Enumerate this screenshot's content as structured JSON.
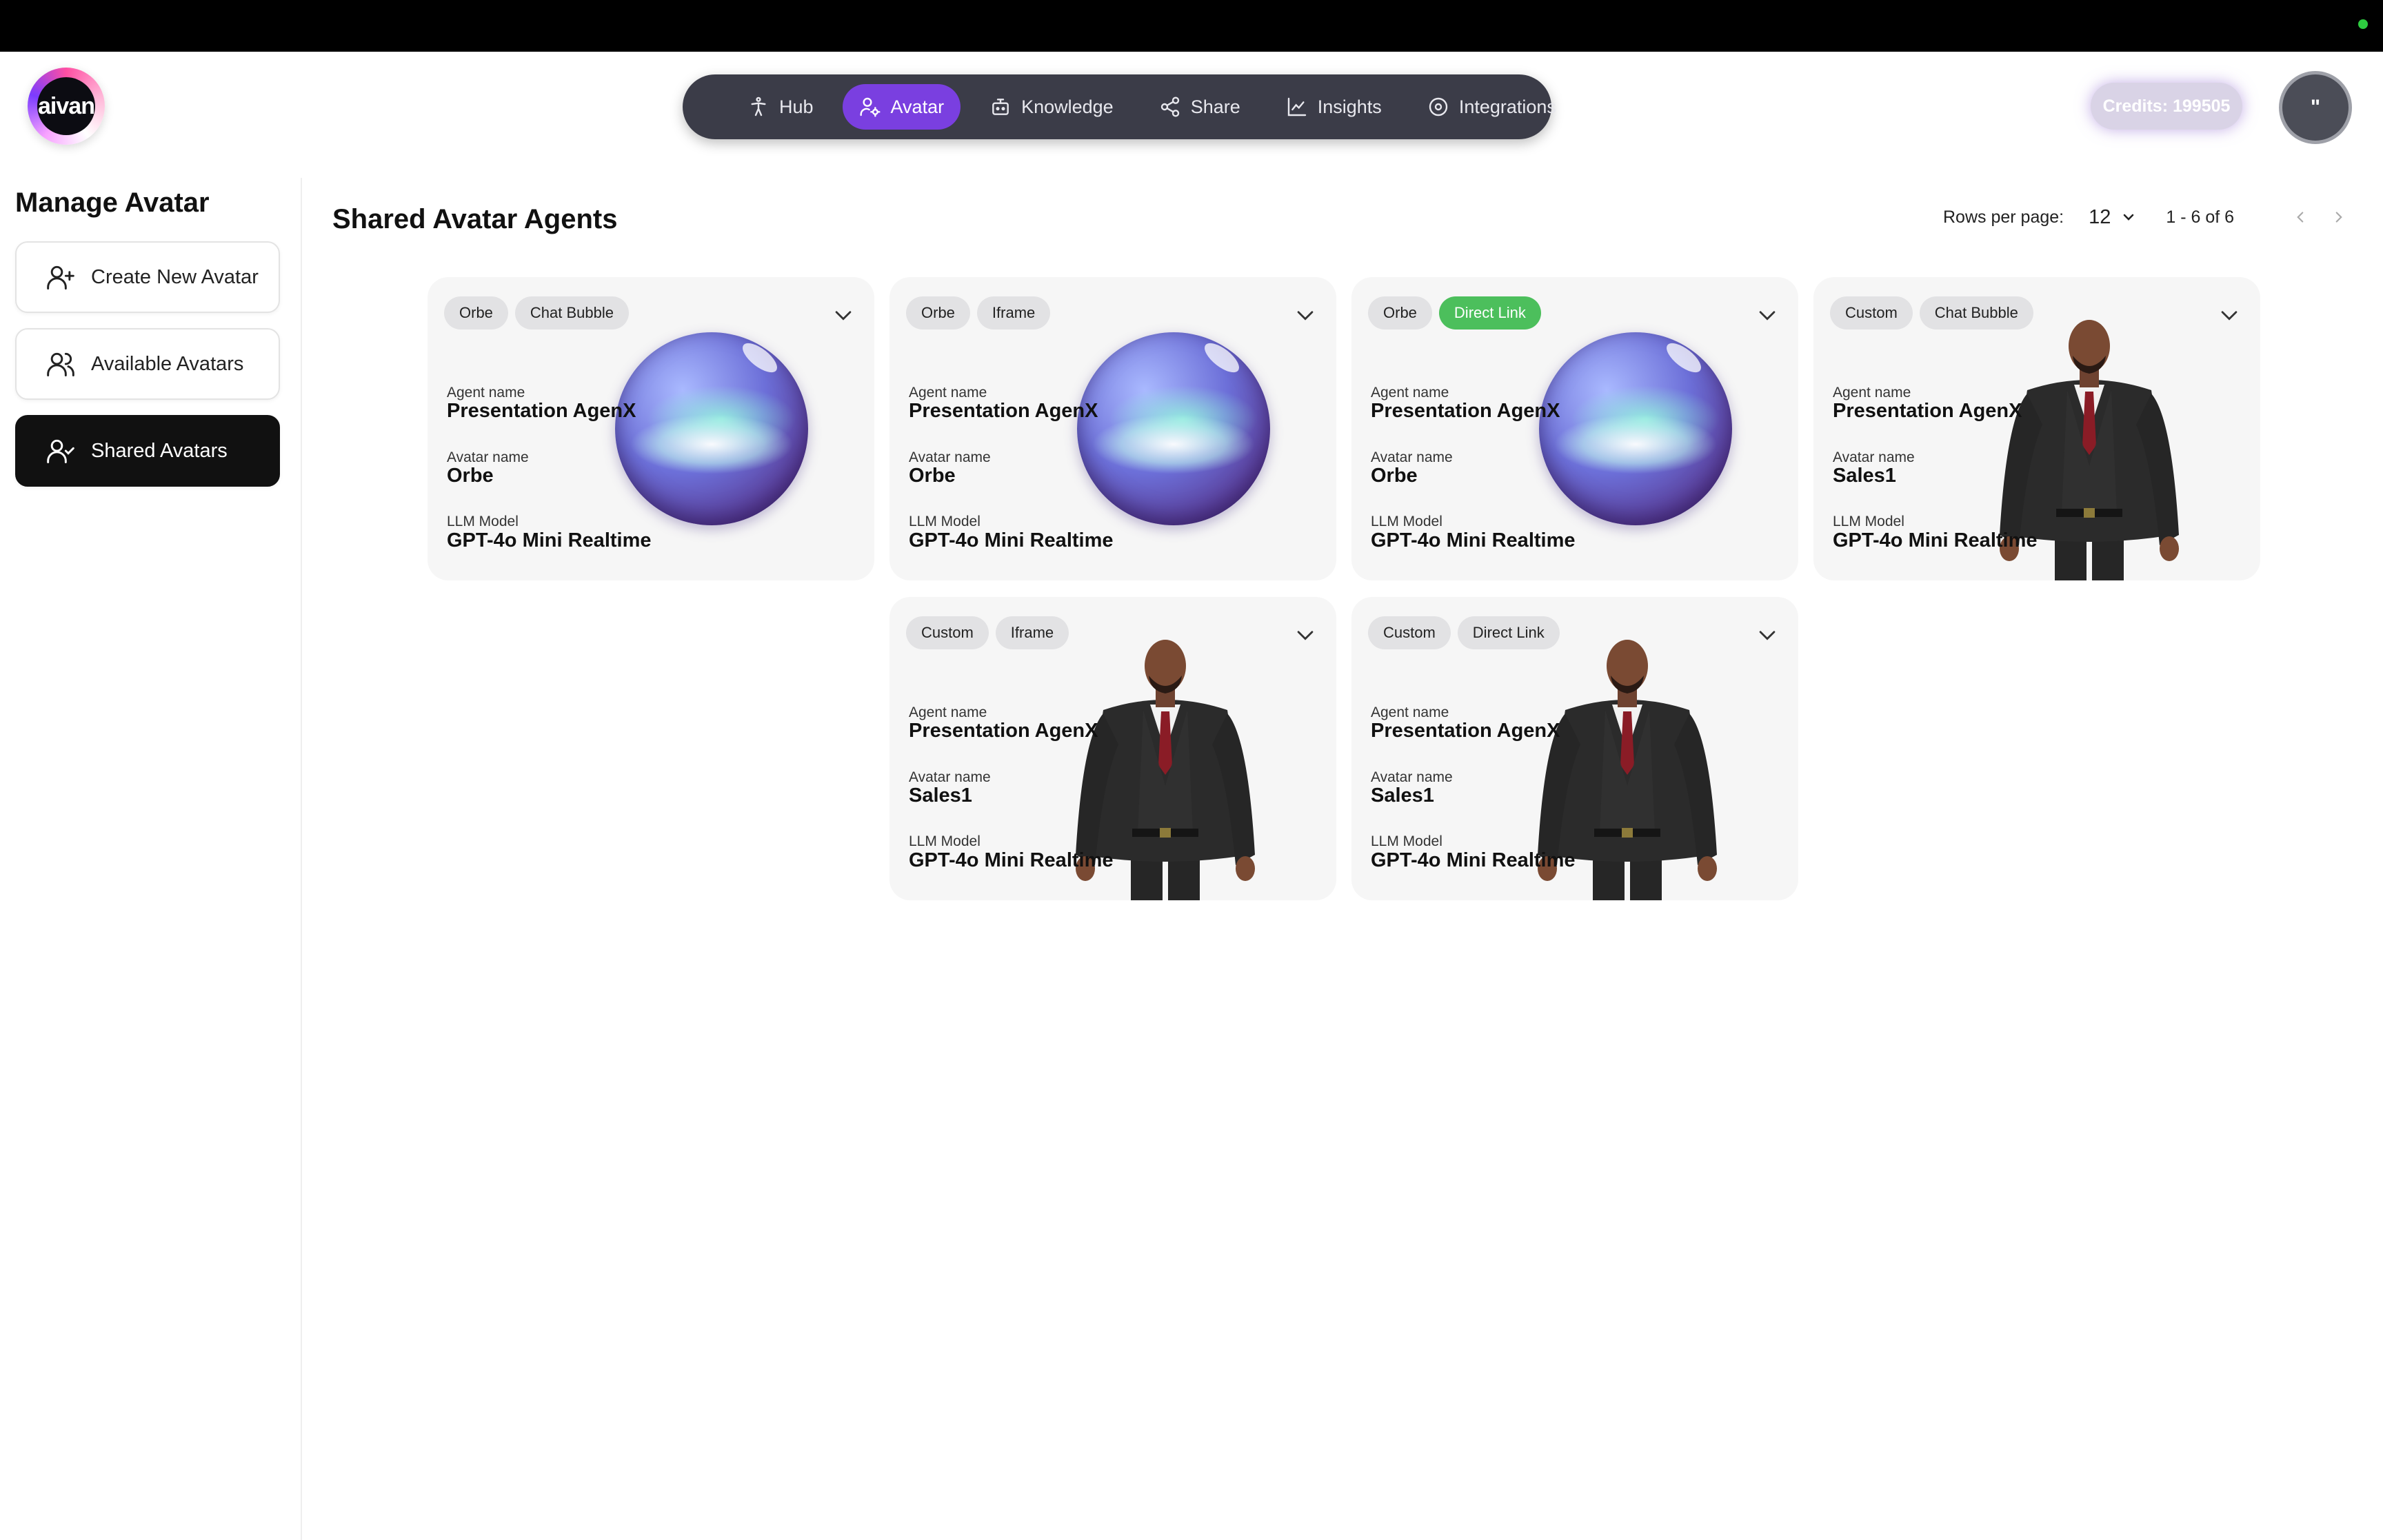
{
  "app": {
    "logo_text": "aivan"
  },
  "nav": {
    "items": [
      {
        "label": "Hub",
        "icon": "person-icon"
      },
      {
        "label": "Avatar",
        "icon": "user-settings-icon",
        "active": true
      },
      {
        "label": "Knowledge",
        "icon": "robot-icon"
      },
      {
        "label": "Share",
        "icon": "share-icon"
      },
      {
        "label": "Insights",
        "icon": "line-chart-icon"
      },
      {
        "label": "Integrations",
        "icon": "integrations-icon"
      }
    ]
  },
  "header": {
    "credits": "Credits: 199505",
    "user_initial": "\""
  },
  "sidebar": {
    "title": "Manage Avatar",
    "items": [
      {
        "label": "Create New Avatar",
        "icon": "user-plus-icon"
      },
      {
        "label": "Available Avatars",
        "icon": "users-icon"
      },
      {
        "label": "Shared Avatars",
        "icon": "user-check-icon",
        "active": true
      }
    ]
  },
  "main": {
    "title": "Shared Avatar Agents",
    "pagination": {
      "rows_label": "Rows per page:",
      "rows_value": "12",
      "range": "1 - 6 of 6"
    }
  },
  "labels": {
    "agent_name": "Agent name",
    "avatar_name": "Avatar name",
    "llm_model": "LLM Model"
  },
  "cards": [
    {
      "type": "Orbe",
      "mode": "Chat Bubble",
      "mode_color": "#e2e2e4",
      "agent_name": "Presentation AgenX",
      "avatar_name": "Orbe",
      "llm_model": "GPT-4o Mini Realtime",
      "visual": "orb"
    },
    {
      "type": "Orbe",
      "mode": "Iframe",
      "mode_color": "#e2e2e4",
      "agent_name": "Presentation AgenX",
      "avatar_name": "Orbe",
      "llm_model": "GPT-4o Mini Realtime",
      "visual": "orb"
    },
    {
      "type": "Orbe",
      "mode": "Direct Link",
      "mode_color": "#4cbf5c",
      "agent_name": "Presentation AgenX",
      "avatar_name": "Orbe",
      "llm_model": "GPT-4o Mini Realtime",
      "visual": "orb"
    },
    {
      "type": "Custom",
      "mode": "Chat Bubble",
      "mode_color": "#e2e2e4",
      "agent_name": "Presentation AgenX",
      "avatar_name": "Sales1",
      "llm_model": "GPT-4o Mini Realtime",
      "visual": "person"
    },
    {
      "type": "Custom",
      "mode": "Iframe",
      "mode_color": "#e2e2e4",
      "agent_name": "Presentation AgenX",
      "avatar_name": "Sales1",
      "llm_model": "GPT-4o Mini Realtime",
      "visual": "person"
    },
    {
      "type": "Custom",
      "mode": "Direct Link",
      "mode_color": "#e2e2e4",
      "agent_name": "Presentation AgenX",
      "avatar_name": "Sales1",
      "llm_model": "GPT-4o Mini Realtime",
      "visual": "person"
    }
  ],
  "colors": {
    "accent": "#7a3fe0",
    "nav_bg": "#3b3c48",
    "active_sidebar": "#111111",
    "direct_link": "#4cbf5c"
  }
}
